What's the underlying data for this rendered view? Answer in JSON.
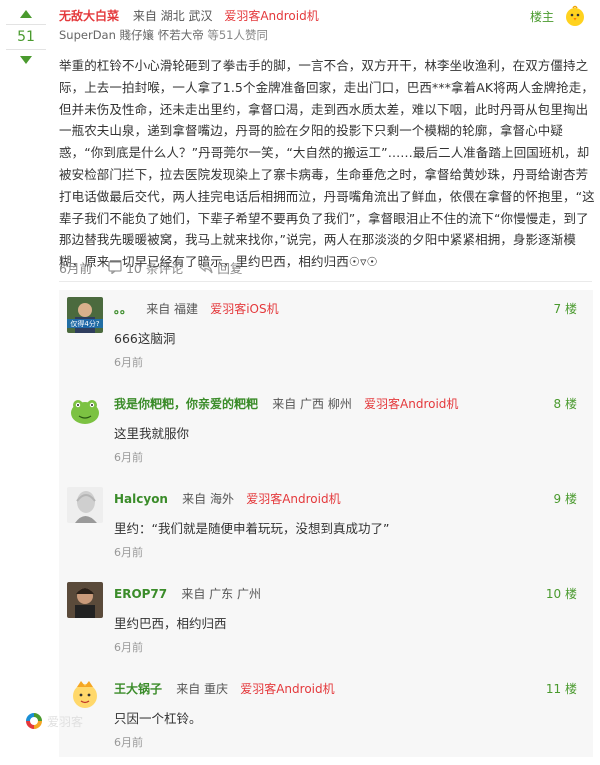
{
  "post": {
    "vote_count": "51",
    "username": "无敌大白菜",
    "from": "来自 湖北 武汉",
    "device": "爱羽客Android机",
    "floor_label": "楼主",
    "likers": "SuperDan 賤仔孃 怀若大帝",
    "likes_suffix": "等51人赞同",
    "body": "举重的杠铃不小心滑轮砸到了拳击手的脚，一言不合，双方开干，林李坐收渔利，在双方僵持之际，上去一拍封喉，一人拿了1.5个金牌准备回家，走出门口，巴西***拿着AK将两人金牌抢走，但并未伤及性命，还未走出里约，拿督口渴，走到西水质太差，难以下咽，此时丹哥从包里掏出一瓶农夫山泉，递到拿督嘴边，丹哥的脸在夕阳的投影下只剩一个模糊的轮廓，拿督心中疑惑，“你到底是什么人？”丹哥莞尔一笑，“大自然的搬运工”……最后二人准备踏上回国班机，却被安检部门拦下，拉去医院发现染上了寨卡病毒，生命垂危之时，拿督给黄妙珠，丹哥给谢杏芳打电话做最后交代，两人挂完电话后相拥而泣，丹哥嘴角流出了鲜血，依偎在拿督的怀抱里，“这辈子我们不能负了她们，下辈子希望不要再负了我们”，拿督眼泪止不住的流下“你慢慢走，到了那边替我先暖暖被窝，我马上就来找你，”说完，两人在那淡淡的夕阳中紧紧相拥，身影逐渐模糊，原来一切早已经有了暗示，里约巴西，相约归西☉▿☉",
    "time": "6月前",
    "comments_label": "10 条评论",
    "reply_label": "回复"
  },
  "comments": [
    {
      "user": "。。",
      "from": "来自 福建",
      "device": "爱羽客iOS机",
      "floor": "7 楼",
      "text": "666这脑洞",
      "time": "6月前",
      "avatar_caption": "仅得4分?"
    },
    {
      "user": "我是你粑粑，你亲爱的粑粑",
      "from": "来自 广西 柳州",
      "device": "爱羽客Android机",
      "floor": "8 楼",
      "text": "这里我就服你",
      "time": "6月前"
    },
    {
      "user": "Halcyon",
      "from": "来自 海外",
      "device": "爱羽客Android机",
      "floor": "9 楼",
      "text": "里约：“我们就是随便申着玩玩，没想到真成功了”",
      "time": "6月前"
    },
    {
      "user": "EROP77",
      "from": "来自 广东 广州",
      "device": "",
      "floor": "10 楼",
      "text": "里约巴西，相约归西",
      "time": "6月前"
    },
    {
      "user": "王大锅子",
      "from": "来自 重庆",
      "device": "爱羽客Android机",
      "floor": "11 楼",
      "text": "只因一个杠铃。",
      "time": "6月前"
    }
  ],
  "watermark": "爱羽客",
  "colors": {
    "accent_green": "#4a9a2e",
    "accent_red": "#e4393c",
    "comment_bg": "#f7f7f7"
  }
}
